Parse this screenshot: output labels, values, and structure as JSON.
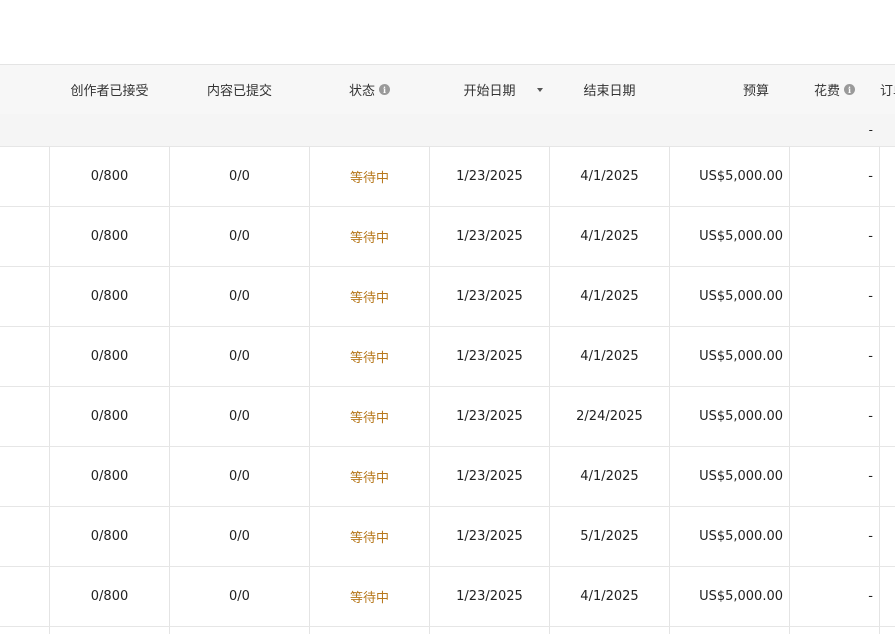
{
  "table": {
    "headers": {
      "accepted": "创作者已接受",
      "submitted": "内容已提交",
      "status": "状态",
      "start": "开始日期",
      "end": "结束日期",
      "budget": "预算",
      "spend": "花费",
      "orders": "订单"
    },
    "summary": {
      "spend": "-"
    },
    "rows": [
      {
        "accepted": "0/800",
        "submitted": "0/0",
        "status": "等待中",
        "start": "1/23/2025",
        "end": "4/1/2025",
        "budget": "US$5,000.00",
        "spend": "-"
      },
      {
        "accepted": "0/800",
        "submitted": "0/0",
        "status": "等待中",
        "start": "1/23/2025",
        "end": "4/1/2025",
        "budget": "US$5,000.00",
        "spend": "-"
      },
      {
        "accepted": "0/800",
        "submitted": "0/0",
        "status": "等待中",
        "start": "1/23/2025",
        "end": "4/1/2025",
        "budget": "US$5,000.00",
        "spend": "-"
      },
      {
        "accepted": "0/800",
        "submitted": "0/0",
        "status": "等待中",
        "start": "1/23/2025",
        "end": "4/1/2025",
        "budget": "US$5,000.00",
        "spend": "-"
      },
      {
        "accepted": "0/800",
        "submitted": "0/0",
        "status": "等待中",
        "start": "1/23/2025",
        "end": "2/24/2025",
        "budget": "US$5,000.00",
        "spend": "-"
      },
      {
        "accepted": "0/800",
        "submitted": "0/0",
        "status": "等待中",
        "start": "1/23/2025",
        "end": "4/1/2025",
        "budget": "US$5,000.00",
        "spend": "-"
      },
      {
        "accepted": "0/800",
        "submitted": "0/0",
        "status": "等待中",
        "start": "1/23/2025",
        "end": "5/1/2025",
        "budget": "US$5,000.00",
        "spend": "-"
      },
      {
        "accepted": "0/800",
        "submitted": "0/0",
        "status": "等待中",
        "start": "1/23/2025",
        "end": "4/1/2025",
        "budget": "US$5,000.00",
        "spend": "-"
      }
    ]
  },
  "icons": {
    "info": "info-icon",
    "sort": "sort-descending-icon"
  },
  "colors": {
    "status_pending": "#b7781c",
    "header_bg": "#f7f7f7"
  }
}
